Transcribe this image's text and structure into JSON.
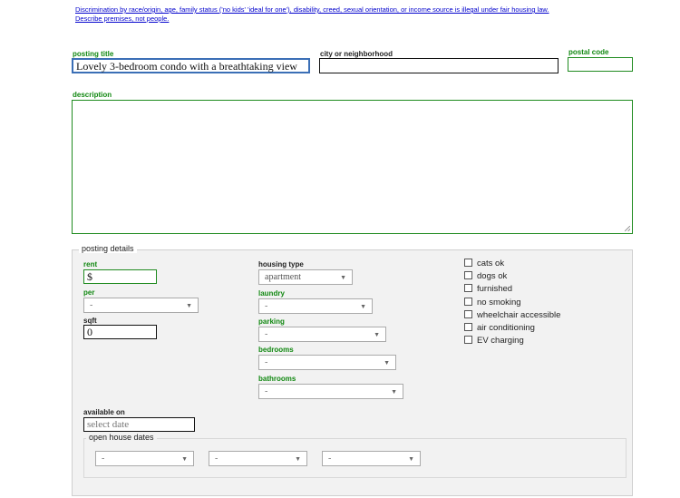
{
  "notice": {
    "line1": "Discrimination by race/origin, age, family status ('no kids' 'ideal for one'), disability, creed, sexual orientation, or income source is illegal under fair housing law.",
    "line2": "Describe premises, not people."
  },
  "posting_title": {
    "label": "posting title",
    "value": "Lovely 3-bedroom condo with a breathtaking view"
  },
  "city": {
    "label": "city or neighborhood",
    "value": ""
  },
  "postal": {
    "label": "postal code",
    "value": ""
  },
  "description": {
    "label": "description",
    "value": ""
  },
  "details": {
    "legend": "posting details",
    "rent": {
      "label": "rent",
      "value": "$"
    },
    "per": {
      "label": "per",
      "value": "-"
    },
    "sqft": {
      "label": "sqft",
      "value": "0"
    },
    "housing_type": {
      "label": "housing type",
      "value": "apartment"
    },
    "laundry": {
      "label": "laundry",
      "value": "-"
    },
    "parking": {
      "label": "parking",
      "value": "-"
    },
    "bedrooms": {
      "label": "bedrooms",
      "value": "-"
    },
    "bathrooms": {
      "label": "bathrooms",
      "value": "-"
    },
    "available_on": {
      "label": "available on",
      "placeholder": "select date"
    },
    "open_house": {
      "legend": "open house dates",
      "values": [
        "-",
        "-",
        "-"
      ]
    },
    "checkboxes": [
      {
        "label": "cats ok",
        "checked": false
      },
      {
        "label": "dogs ok",
        "checked": false
      },
      {
        "label": "furnished",
        "checked": false
      },
      {
        "label": "no smoking",
        "checked": false
      },
      {
        "label": "wheelchair accessible",
        "checked": false
      },
      {
        "label": "air conditioning",
        "checked": false
      },
      {
        "label": "EV charging",
        "checked": false
      }
    ]
  }
}
